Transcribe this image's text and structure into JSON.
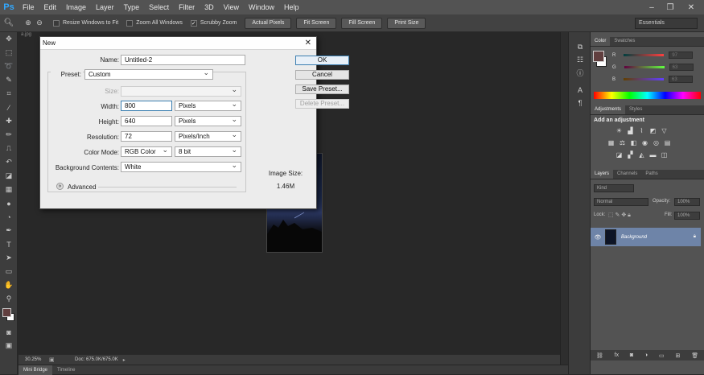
{
  "app": {
    "logo": "Ps"
  },
  "menu": [
    "File",
    "Edit",
    "Image",
    "Layer",
    "Type",
    "Select",
    "Filter",
    "3D",
    "View",
    "Window",
    "Help"
  ],
  "window_controls": {
    "minimize": "–",
    "restore": "❐",
    "close": "✕"
  },
  "options_bar": {
    "resize_windows_label": "Resize Windows to Fit",
    "zoom_all_label": "Zoom All Windows",
    "scrubby_zoom_label": "Scrubby Zoom",
    "actual_pixels": "Actual Pixels",
    "fit_screen": "Fit Screen",
    "fill_screen": "Fill Screen",
    "print_size": "Print Size",
    "workspace": "Essentials"
  },
  "document": {
    "tab_title": "a.jpg"
  },
  "status": {
    "zoom": "30.25%",
    "doc": "Doc: 675.0K/675.0K"
  },
  "bottom_tabs": [
    "Mini Bridge",
    "Timeline"
  ],
  "color_panel": {
    "tabs": [
      "Color",
      "Swatches"
    ],
    "rows": [
      {
        "label": "R",
        "value": "97"
      },
      {
        "label": "G",
        "value": "63"
      },
      {
        "label": "B",
        "value": "63"
      }
    ],
    "foreground": "#613f3f"
  },
  "adjustments_panel": {
    "tabs": [
      "Adjustments",
      "Styles"
    ],
    "heading": "Add an adjustment"
  },
  "layers_panel": {
    "tabs": [
      "Layers",
      "Channels",
      "Paths"
    ],
    "kind": "Kind",
    "blend_mode": "Normal",
    "opacity_label": "Opacity:",
    "opacity": "100%",
    "lock_label": "Lock:",
    "fill_label": "Fill:",
    "fill": "100%",
    "layer_name": "Background"
  },
  "dialog": {
    "title": "New",
    "name_label": "Name:",
    "name_value": "Untitled-2",
    "preset_label": "Preset:",
    "preset_value": "Custom",
    "size_label": "Size:",
    "width_label": "Width:",
    "width_value": "800",
    "width_unit": "Pixels",
    "height_label": "Height:",
    "height_value": "640",
    "height_unit": "Pixels",
    "resolution_label": "Resolution:",
    "resolution_value": "72",
    "resolution_unit": "Pixels/Inch",
    "color_mode_label": "Color Mode:",
    "color_mode_value": "RGB Color",
    "bit_depth": "8 bit",
    "background_label": "Background Contents:",
    "background_value": "White",
    "advanced_label": "Advanced",
    "ok": "OK",
    "cancel": "Cancel",
    "save_preset": "Save Preset...",
    "delete_preset": "Delete Preset...",
    "image_size_label": "Image Size:",
    "image_size_value": "1.46M"
  }
}
